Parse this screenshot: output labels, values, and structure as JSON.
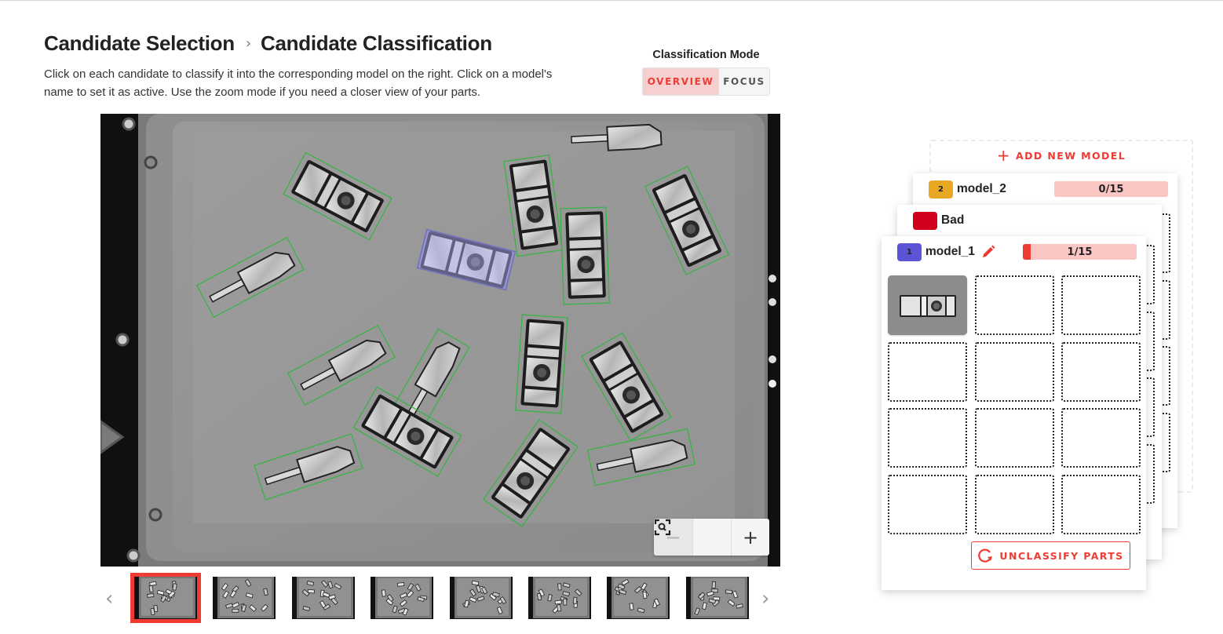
{
  "header": {
    "breadcrumb": [
      {
        "label": "Candidate Selection"
      },
      {
        "label": "Candidate Classification"
      }
    ],
    "separator": "›",
    "instructions": "Click on each candidate to classify it into the corresponding model on the right. Click on a model's name to set it as active. Use the zoom mode if you need a closer view of your parts."
  },
  "classification_mode": {
    "label": "Classification Mode",
    "options": [
      {
        "label": "OVERVIEW",
        "active": true
      },
      {
        "label": "FOCUS",
        "active": false
      }
    ]
  },
  "viewer": {
    "zoom_out_icon": "minus-icon",
    "zoom_fit_icon": "zoom-fit-icon",
    "zoom_in_icon": "plus-icon",
    "zoom_out_label": "−",
    "zoom_in_label": "+",
    "candidate_box_color": "#33b540",
    "selected_candidate_color": "#5b55d6",
    "candidates_total": 16,
    "candidates_classified": 1
  },
  "thumbnails": {
    "prev_icon": "chevron-left-icon",
    "next_icon": "chevron-right-icon",
    "prev_label": "‹",
    "next_label": "›",
    "count": 8,
    "selected_index": 0
  },
  "models_panel": {
    "add_model_label": "ADD NEW MODEL",
    "add_model_icon": "plus-icon",
    "models": [
      {
        "id": "model_2",
        "badge": "2",
        "name": "model_2",
        "color": "#e9a823",
        "progress": "0/15",
        "classified": 0,
        "capacity": 15
      },
      {
        "id": "bad",
        "badge": "",
        "name": "Bad",
        "color": "#d0021b"
      },
      {
        "id": "model_1",
        "badge": "1",
        "name": "model_1",
        "color": "#5b55d6",
        "progress": "1/15",
        "classified": 1,
        "capacity": 15,
        "active": true,
        "edit_icon": "pencil-icon"
      }
    ],
    "unclassify_label": "UNCLASSIFY PARTS",
    "unclassify_icon": "refresh-icon"
  },
  "colors": {
    "accent": "#ee3b33",
    "accent_light": "#f9c6c3",
    "mode_active_bg": "#f6cfcf"
  }
}
